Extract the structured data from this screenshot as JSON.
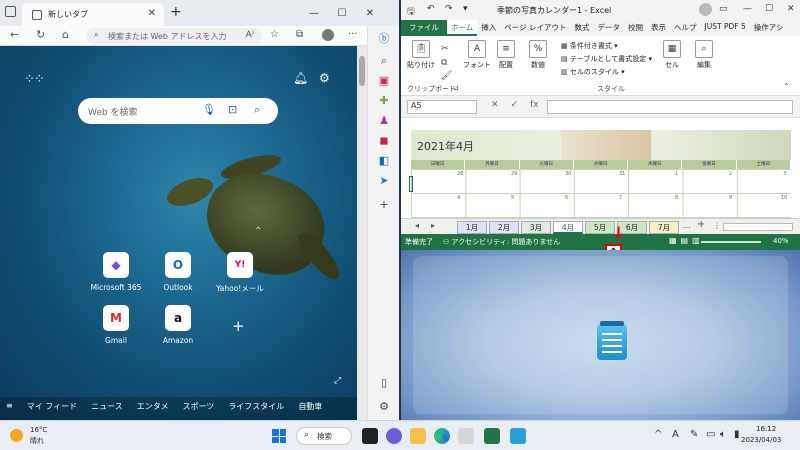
{
  "edge": {
    "tab_title": "新しいタブ",
    "tab_close": "✕",
    "new_tab": "+",
    "win_min": "—",
    "win_max": "☐",
    "win_close": "✕",
    "address_placeholder": "検索または Web アドレスを入力",
    "nav_back": "←",
    "nav_refresh": "↻",
    "nav_home": "⌂",
    "search_box_placeholder": "Web を検索",
    "tiles": [
      {
        "label": "Microsoft 365",
        "glyph": "◆",
        "color": "#7a4fd6"
      },
      {
        "label": "Outlook",
        "glyph": "O",
        "color": "#0f6cbd"
      },
      {
        "label": "Yahoo!メール",
        "glyph": "Y!",
        "color": "#e1005a"
      },
      {
        "label": "Gmail",
        "glyph": "M",
        "color": "#d93025"
      },
      {
        "label": "Amazon",
        "glyph": "a",
        "color": "#111111"
      }
    ],
    "tile_add": "+",
    "feed_items": [
      "マイ フィード",
      "ニュース",
      "エンタメ",
      "スポーツ",
      "ライフスタイル",
      "自動車"
    ]
  },
  "excel": {
    "doc_title": "季節の写真カレンダー1 - Excel",
    "tabs": [
      "ファイル",
      "ホーム",
      "挿入",
      "ページ レイアウト",
      "数式",
      "データ",
      "校閲",
      "表示",
      "ヘルプ",
      "JUST PDF 5",
      "操作アシ"
    ],
    "ribbon": {
      "paste": "貼り付け",
      "font": "フォント",
      "align": "配置",
      "number": "数値",
      "cond_format": "条件付き書式",
      "table_format": "テーブルとして書式設定",
      "cell_style": "セルのスタイル",
      "cell": "セル",
      "edit": "編集",
      "clipboard_group": "クリップボード",
      "style_group": "スタイル"
    },
    "name_box": "A5",
    "fx_cancel": "✕",
    "fx_enter": "✓",
    "fx_label": "fx",
    "sheet_title": "2021年4月",
    "weekday_headers": [
      "日曜日",
      "月曜日",
      "火曜日",
      "水曜日",
      "木曜日",
      "金曜日",
      "土曜日"
    ],
    "row1_days": [
      "28",
      "29",
      "30",
      "31",
      "1",
      "2",
      "3"
    ],
    "row2_days": [
      "4",
      "5",
      "6",
      "7",
      "8",
      "9",
      "10"
    ],
    "sheet_tabs": [
      "1月",
      "2月",
      "3月",
      "4月",
      "5月",
      "6月",
      "7月"
    ],
    "sheet_more": "...",
    "sheet_add": "+",
    "status_ready": "準備完了",
    "status_accessibility": "アクセシビリティ: 問題ありません",
    "zoom": "40%"
  },
  "taskbar": {
    "temp": "16°C",
    "condition": "晴れ",
    "search_label": "検索",
    "time": "16:12",
    "date": "2023/04/03",
    "ime": "A",
    "chevron": "^"
  }
}
